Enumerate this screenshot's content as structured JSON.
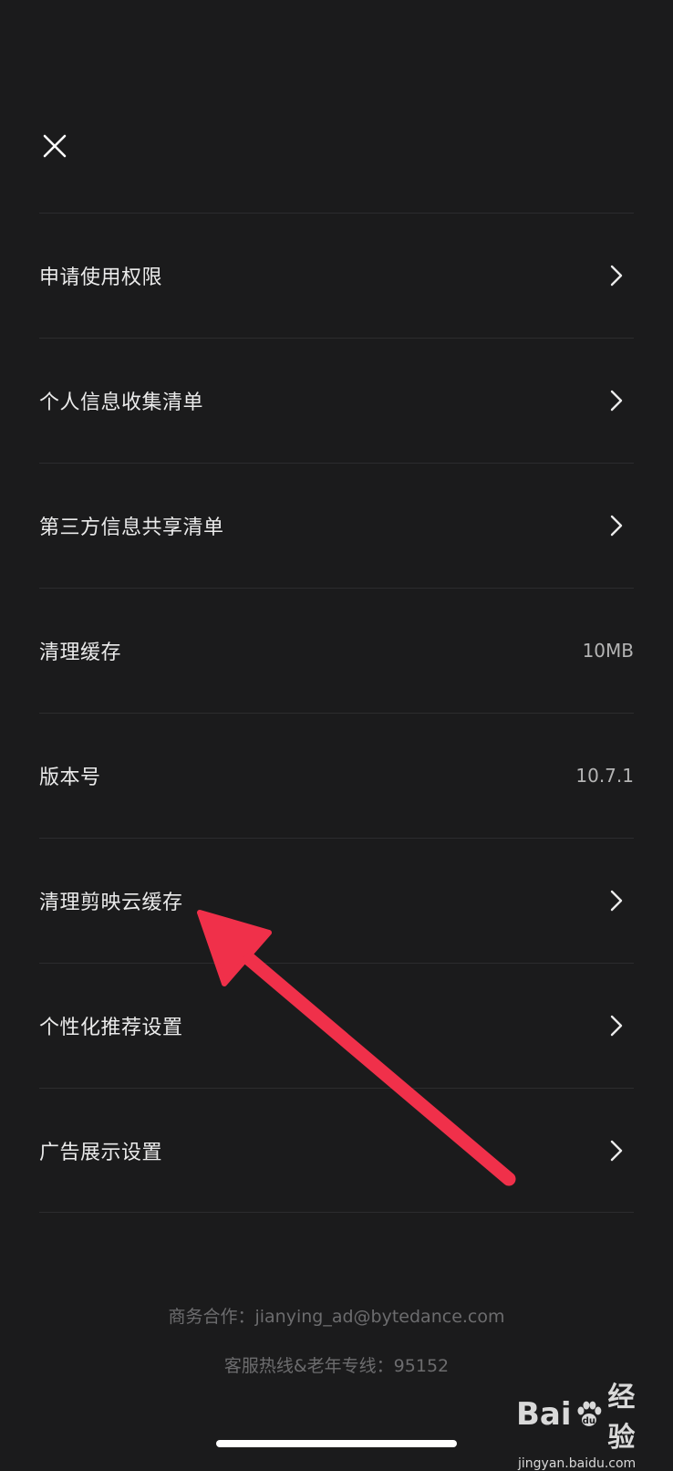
{
  "header": {
    "close_icon": "close-icon"
  },
  "menu": {
    "items": [
      {
        "label": "申请使用权限",
        "value": null,
        "icon": "chevron-right-icon"
      },
      {
        "label": "个人信息收集清单",
        "value": null,
        "icon": "chevron-right-icon"
      },
      {
        "label": "第三方信息共享清单",
        "value": null,
        "icon": "chevron-right-icon"
      },
      {
        "label": "清理缓存",
        "value": "10MB",
        "icon": null
      },
      {
        "label": "版本号",
        "value": "10.7.1",
        "icon": null
      },
      {
        "label": "清理剪映云缓存",
        "value": null,
        "icon": "chevron-right-icon"
      },
      {
        "label": "个性化推荐设置",
        "value": null,
        "icon": "chevron-right-icon"
      },
      {
        "label": "广告展示设置",
        "value": null,
        "icon": "chevron-right-icon"
      }
    ]
  },
  "footer": {
    "business": "商务合作：jianying_ad@bytedance.com",
    "hotline": "客服热线&老年专线：95152"
  },
  "watermark": {
    "brand_prefix": "Bai",
    "brand_suffix": "经验",
    "url": "jingyan.baidu.com"
  },
  "colors": {
    "background": "#1b1b1c",
    "divider": "#2c2c2e",
    "text": "#ebebeb",
    "annotation_arrow": "#f0304a"
  }
}
